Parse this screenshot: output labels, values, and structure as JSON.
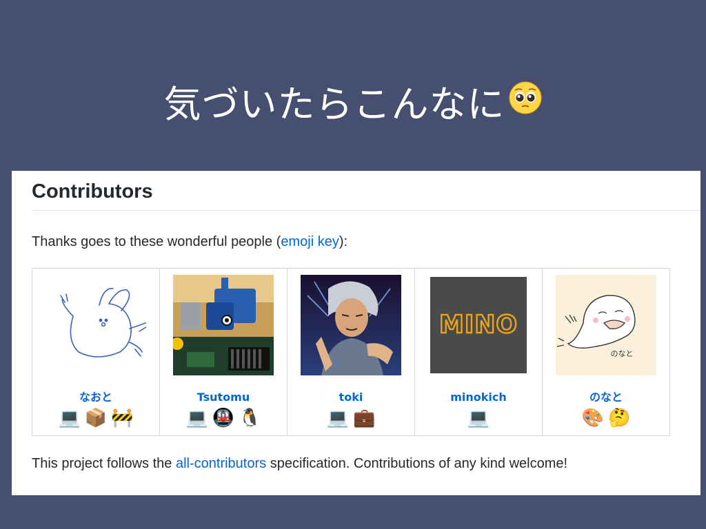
{
  "slide": {
    "title": "気づいたらこんなに",
    "title_emoji": "🥺"
  },
  "section": {
    "heading": "Contributors",
    "thanks_prefix": "Thanks goes to these wonderful people (",
    "emoji_key_link": "emoji key",
    "thanks_suffix": "):",
    "footer_prefix": "This project follows the ",
    "footer_link": "all-contributors",
    "footer_suffix": " specification. Contributions of any kind welcome!"
  },
  "contributors": [
    {
      "name": "なおと",
      "avatar": "rabbit-drawing",
      "badges": [
        "💻",
        "📦",
        "🚧"
      ]
    },
    {
      "name": "Tsutomu",
      "avatar": "lego-whale-photo",
      "badges": [
        "💻",
        "🚇",
        "🐧"
      ]
    },
    {
      "name": "toki",
      "avatar": "anime-fighter",
      "badges": [
        "💻",
        "💼"
      ]
    },
    {
      "name": "minokich",
      "avatar": "mino-logo",
      "avatar_text": "MINO",
      "badges": [
        "💻"
      ]
    },
    {
      "name": "のなと",
      "avatar": "ghost-drawing",
      "avatar_text": "のなと",
      "badges": [
        "🎨",
        "🤔"
      ]
    }
  ],
  "colors": {
    "background": "#464f70",
    "link": "#0366d6",
    "text": "#24292e",
    "mino_bg": "#4a4a4a",
    "mino_fg": "#e8a320"
  }
}
